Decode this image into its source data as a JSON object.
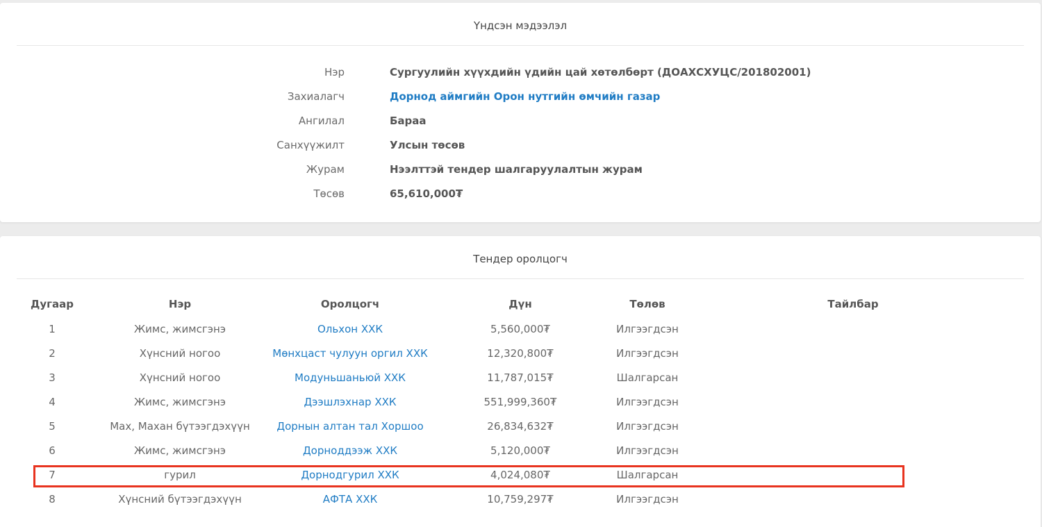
{
  "basic_info": {
    "title": "Үндсэн мэдээлэл",
    "rows": [
      {
        "label": "Нэр",
        "value": "Сургуулийн хүүхдийн үдийн цай хөтөлбөрт (ДОАХСХУЦС/201802001)"
      },
      {
        "label": "Захиалагч",
        "value": "Дорнод аймгийн Орон нутгийн өмчийн газар"
      },
      {
        "label": "Ангилал",
        "value": "Бараа"
      },
      {
        "label": "Санхүүжилт",
        "value": "Улсын төсөв"
      },
      {
        "label": "Журам",
        "value": "Нээлттэй тендер шалгаруулалтын журам"
      },
      {
        "label": "Төсөв",
        "value": "65,610,000₮"
      }
    ]
  },
  "bidders": {
    "title": "Тендер оролцогч",
    "columns": [
      "Дугаар",
      "Нэр",
      "Оролцогч",
      "Дүн",
      "Төлөв",
      "Тайлбар"
    ],
    "rows": [
      {
        "no": "1",
        "name": "Жимс, жимсгэнэ",
        "bidder": "Ольхон ХХК",
        "amount": "5,560,000₮",
        "status": "Илгээгдсэн",
        "note": ""
      },
      {
        "no": "2",
        "name": "Хүнсний ногоо",
        "bidder": "Мөнхцаст чулуун оргил ХХК",
        "amount": "12,320,800₮",
        "status": "Илгээгдсэн",
        "note": ""
      },
      {
        "no": "3",
        "name": "Хүнсний ногоо",
        "bidder": "Модуньшаньюй ХХК",
        "amount": "11,787,015₮",
        "status": "Шалгарсан",
        "note": ""
      },
      {
        "no": "4",
        "name": "Жимс, жимсгэнэ",
        "bidder": "Дээшлэхнар ХХК",
        "amount": "551,999,360₮",
        "status": "Илгээгдсэн",
        "note": ""
      },
      {
        "no": "5",
        "name": "Мах, Махан бүтээгдэхүүн",
        "bidder": "Дорнын алтан тал Хоршоо",
        "amount": "26,834,632₮",
        "status": "Илгээгдсэн",
        "note": ""
      },
      {
        "no": "6",
        "name": "Жимс, жимсгэнэ",
        "bidder": "Дорноддээж ХХК",
        "amount": "5,120,000₮",
        "status": "Илгээгдсэн",
        "note": ""
      },
      {
        "no": "7",
        "name": "гурил",
        "bidder": "Дорнодгурил ХХК",
        "amount": "4,024,080₮",
        "status": "Шалгарсан",
        "note": ""
      },
      {
        "no": "8",
        "name": "Хүнсний бүтээгдэхүүн",
        "bidder": "АФТА ХХК",
        "amount": "10,759,297₮",
        "status": "Илгээгдсэн",
        "note": ""
      }
    ]
  },
  "colors": {
    "link": "#1f7cc4",
    "highlight": "#e8331f"
  }
}
